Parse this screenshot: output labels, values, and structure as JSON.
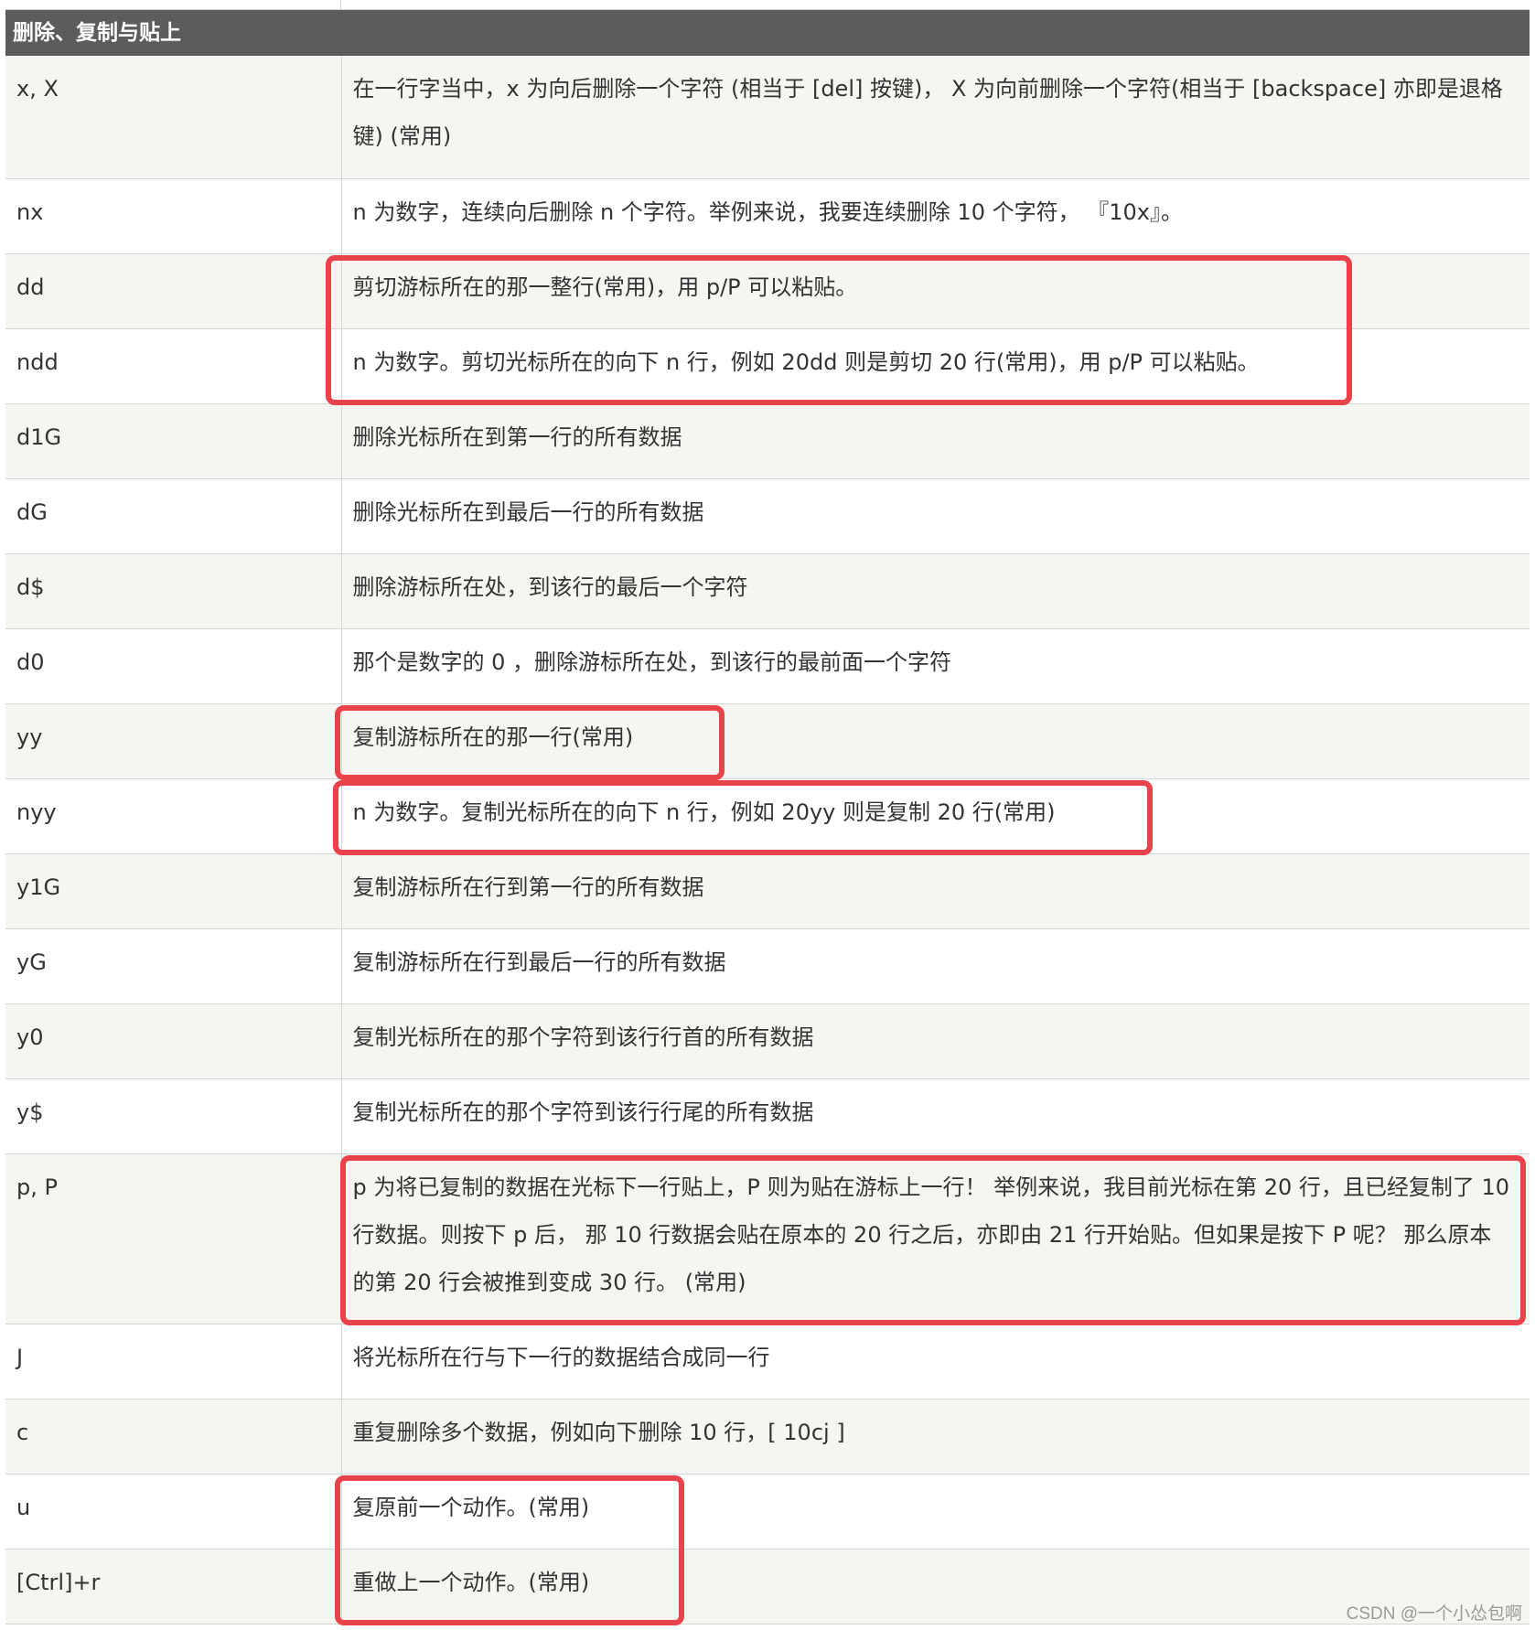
{
  "section_title": "删除、复制与贴上",
  "rows": [
    {
      "key": "x, X",
      "desc": "在一行字当中，x 为向后删除一个字符 (相当于 [del] 按键)， X 为向前删除一个字符(相当于 [backspace] 亦即是退格键) (常用)"
    },
    {
      "key": "nx",
      "desc": "n 为数字，连续向后删除 n 个字符。举例来说，我要连续删除 10 个字符， 『10x』。"
    },
    {
      "key": "dd",
      "desc": "剪切游标所在的那一整行(常用)，用 p/P 可以粘贴。"
    },
    {
      "key": "ndd",
      "desc": "n 为数字。剪切光标所在的向下 n 行，例如 20dd 则是剪切 20 行(常用)，用 p/P 可以粘贴。"
    },
    {
      "key": "d1G",
      "desc": "删除光标所在到第一行的所有数据"
    },
    {
      "key": "dG",
      "desc": "删除光标所在到最后一行的所有数据"
    },
    {
      "key": "d$",
      "desc": "删除游标所在处，到该行的最后一个字符"
    },
    {
      "key": "d0",
      "desc": "那个是数字的 0 ，删除游标所在处，到该行的最前面一个字符"
    },
    {
      "key": "yy",
      "desc": "复制游标所在的那一行(常用)"
    },
    {
      "key": "nyy",
      "desc": "n 为数字。复制光标所在的向下 n 行，例如 20yy 则是复制 20 行(常用)"
    },
    {
      "key": "y1G",
      "desc": "复制游标所在行到第一行的所有数据"
    },
    {
      "key": "yG",
      "desc": "复制游标所在行到最后一行的所有数据"
    },
    {
      "key": "y0",
      "desc": "复制光标所在的那个字符到该行行首的所有数据"
    },
    {
      "key": "y$",
      "desc": "复制光标所在的那个字符到该行行尾的所有数据"
    },
    {
      "key": "p, P",
      "desc": "p 为将已复制的数据在光标下一行贴上，P 则为贴在游标上一行！ 举例来说，我目前光标在第 20 行，且已经复制了 10 行数据。则按下 p 后， 那 10 行数据会贴在原本的 20 行之后，亦即由 21 行开始贴。但如果是按下 P 呢？ 那么原本的第 20 行会被推到变成 30 行。 (常用)"
    },
    {
      "key": "J",
      "desc": "将光标所在行与下一行的数据结合成同一行"
    },
    {
      "key": "c",
      "desc": "重复删除多个数据，例如向下删除 10 行，[ 10cj ]"
    },
    {
      "key": "u",
      "desc": "复原前一个动作。(常用)"
    },
    {
      "key": "[Ctrl]+r",
      "desc": "重做上一个动作。(常用)"
    }
  ],
  "annotation_color": "#e8434a",
  "watermark": "CSDN @一个小怂包啊"
}
